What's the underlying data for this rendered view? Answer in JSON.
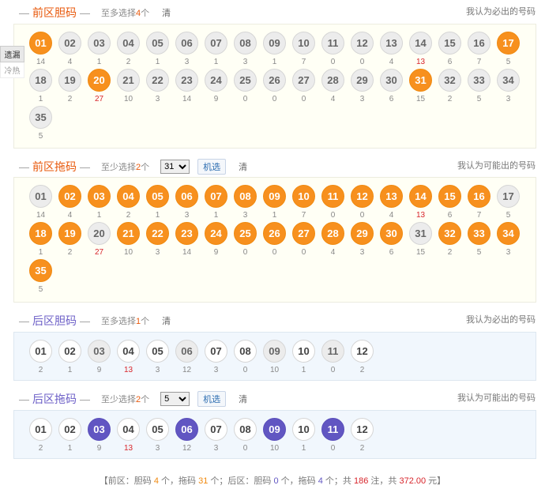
{
  "sections": [
    {
      "title": "前区胆码",
      "hint_pre": "至多选择",
      "hint_num": "4",
      "hint_suf": "个",
      "clear": "清",
      "right_note": "我认为必出的号码"
    },
    {
      "title": "前区拖码",
      "hint_pre": "至少选择",
      "hint_num": "2",
      "hint_suf": "个",
      "select_value": "31",
      "random_label": "机选",
      "clear": "清",
      "right_note": "我认为可能出的号码"
    },
    {
      "title": "后区胆码",
      "hint_pre": "至多选择",
      "hint_num": "1",
      "hint_suf": "个",
      "clear": "清",
      "right_note": "我认为必出的号码"
    },
    {
      "title": "后区拖码",
      "hint_pre": "至少选择",
      "hint_num": "2",
      "hint_suf": "个",
      "select_value": "5",
      "random_label": "机选",
      "clear": "清",
      "right_note": "我认为可能出的号码"
    }
  ],
  "dash": "—",
  "side_tabs": [
    "遗漏",
    "冷热"
  ],
  "front_misses": [
    "14",
    "4",
    "1",
    "2",
    "1",
    "3",
    "1",
    "3",
    "1",
    "7",
    "0",
    "0",
    "4",
    "13",
    "6",
    "7",
    "5",
    "1",
    "2",
    "27",
    "10",
    "3",
    "14",
    "9",
    "0",
    "0",
    "0",
    "4",
    "3",
    "6",
    "15",
    "2",
    "5",
    "3",
    "5"
  ],
  "front_dan_selected": [
    "01",
    "17",
    "20",
    "31"
  ],
  "front_tuo_disabled": [
    "01",
    "17",
    "20",
    "31"
  ],
  "back_misses": [
    "2",
    "1",
    "9",
    "13",
    "3",
    "12",
    "3",
    "0",
    "10",
    "1",
    "0",
    "2"
  ],
  "back_dan_disabled": [
    "03",
    "06",
    "09",
    "11"
  ],
  "back_tuo_selected": [
    "03",
    "06",
    "09",
    "11"
  ],
  "hot_misses": [
    "27",
    "13"
  ],
  "summary": {
    "p1": "【前区：胆码 ",
    "v1": "4",
    "p2": " 个，拖码 ",
    "v2": "31",
    "p3": " 个；后区：胆码 ",
    "v3": "0",
    "p4": " 个，拖码 ",
    "v4": "4",
    "p5": " 个；共 ",
    "v5": "186",
    "p6": " 注，共 ",
    "v6": "372.00",
    "p7": " 元】"
  },
  "colors": {
    "front_accent": "#e8590c",
    "back_accent": "#6c5fc7",
    "ball_orange": "#f7901e",
    "ball_purple": "#6156c2"
  }
}
